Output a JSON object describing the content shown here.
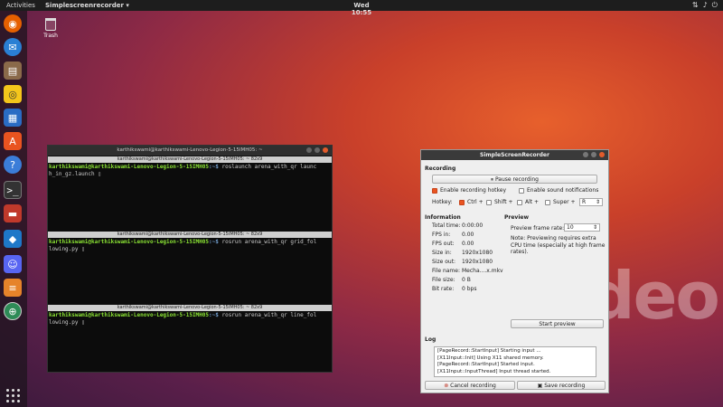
{
  "topbar": {
    "activities": "Activities",
    "app_menu": "Simplescreenrecorder ▾",
    "clock": "Wed 10:55",
    "tray_icons": [
      "network-icon",
      "volume-icon",
      "power-icon"
    ]
  },
  "desktop": {
    "trash_label": "Trash",
    "watermark": "clideo.com"
  },
  "dock": {
    "items": [
      "firefox-icon",
      "thunderbird-icon",
      "files-icon",
      "rhythmbox-icon",
      "writer-icon",
      "software-icon",
      "help-icon",
      "terminal-icon",
      "terminal-red-icon",
      "vscode-icon",
      "discord-icon",
      "stack-icon",
      "globe-icon"
    ],
    "colors": {
      "firefox": "#e66000",
      "thunderbird": "#2a7fd4",
      "files": "#8a6a4a",
      "rhythmbox": "#f4c61b",
      "writer": "#2a6cc4",
      "software": "#e95420",
      "help": "#3b7dd8",
      "terminal": "#333333",
      "terminal_red": "#c0392b",
      "vscode": "#1e78c8",
      "discord": "#5865f2",
      "stack": "#e6832a",
      "globe": "#2e8b57"
    }
  },
  "terminal": {
    "window_title": "karthikswami@karthikswami-Lenovo-Legion-5-15IMH05: ~",
    "panes": [
      {
        "title": "karthikswami@karthikswami-Lenovo-Legion-5-15IMH05: ~ 82x9",
        "user": "karthikswami@karthikswami-Lenovo-Legion-5-15IMH05",
        "path": ":~$",
        "cmd1": " roslaunch arena_with_qr launc",
        "cmd2": "h_in_gz.launch "
      },
      {
        "title": "karthikswami@karthikswami-Lenovo-Legion-5-15IMH05: ~ 82x9",
        "user": "karthikswami@karthikswami-Lenovo-Legion-5-15IMH05",
        "path": ":~$",
        "cmd1": " rosrun arena_with_qr grid_fol",
        "cmd2": "lowing.py "
      },
      {
        "title": "karthikswami@karthikswami-Lenovo-Legion-5-15IMH05: ~ 82x9",
        "user": "karthikswami@karthikswami-Lenovo-Legion-5-15IMH05",
        "path": ":~$",
        "cmd1": " rosrun arena_with_qr line_fol",
        "cmd2": "lowing.py "
      }
    ]
  },
  "ssr": {
    "title": "SimpleScreenRecorder",
    "recording_header": "Recording",
    "pause_button": "Pause recording",
    "enable_hotkey": "Enable recording hotkey",
    "enable_sound": "Enable sound notifications",
    "hotkey_label": "Hotkey:",
    "ctrl": "Ctrl +",
    "shift": "Shift +",
    "alt": "Alt +",
    "super": "Super +",
    "key": "R",
    "information_header": "Information",
    "info": [
      {
        "key": "Total time:",
        "value": "0:00:00"
      },
      {
        "key": "FPS in:",
        "value": "0.00"
      },
      {
        "key": "FPS out:",
        "value": "0.00"
      },
      {
        "key": "Size in:",
        "value": "1920x1080"
      },
      {
        "key": "Size out:",
        "value": "1920x1080"
      },
      {
        "key": "File name:",
        "value": "Mecha....x.mkv"
      },
      {
        "key": "File size:",
        "value": "0 B"
      },
      {
        "key": "Bit rate:",
        "value": "0 bps"
      }
    ],
    "preview_header": "Preview",
    "preview_rate_label": "Preview frame rate:",
    "preview_rate": "10",
    "preview_note": "Note: Previewing requires extra CPU time (especially at high frame rates).",
    "start_preview": "Start preview",
    "log_header": "Log",
    "log": [
      "[PageRecord::StartInput] Starting input ...",
      "[X11Input::Init] Using X11 shared memory.",
      "[PageRecord::StartInput] Started input.",
      "[X11Input::InputThread] Input thread started."
    ],
    "cancel_button": "Cancel recording",
    "save_button": "Save recording"
  }
}
